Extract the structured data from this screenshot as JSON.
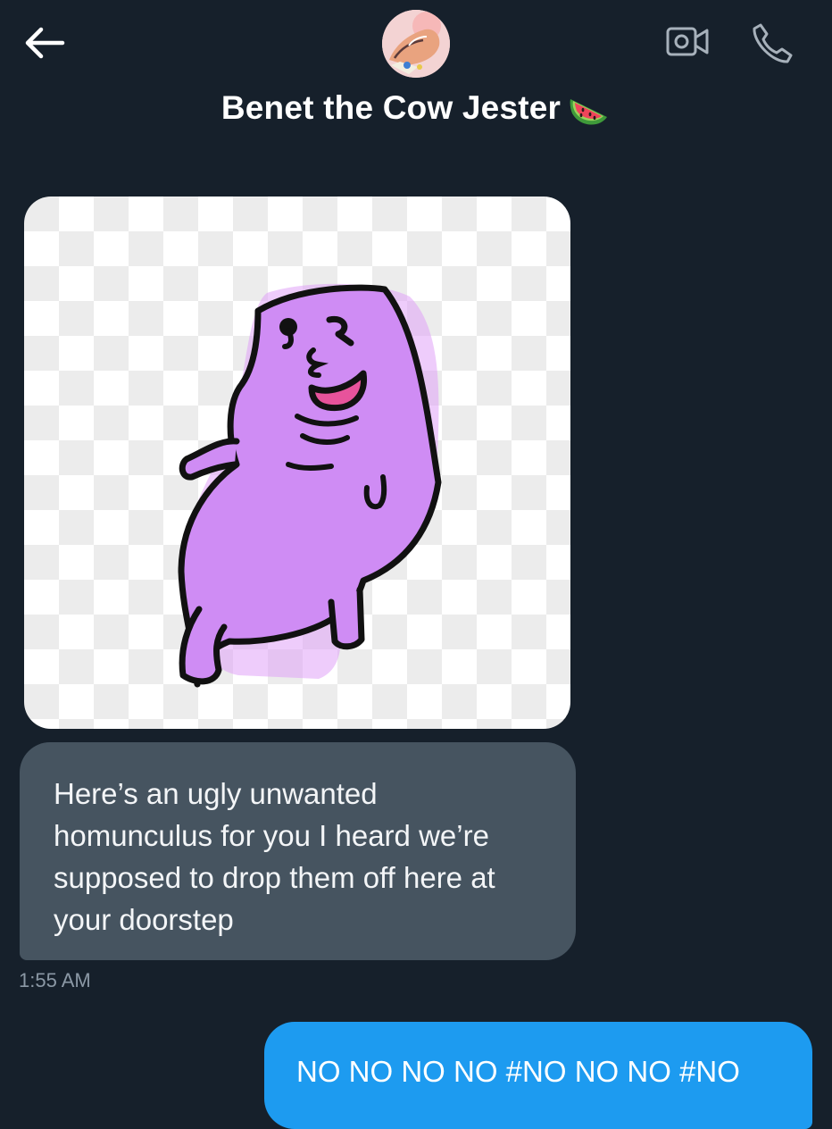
{
  "header": {
    "contact_name": "Benet the Cow Jester"
  },
  "messages": {
    "received_text": "Here’s an ugly unwanted homunculus for you I heard we’re supposed to drop them off here at your doorstep",
    "received_lines": [
      "Here’s an ugly unwanted",
      "homunculus for you I heard we’re",
      "supposed to drop them off here at",
      "your doorstep"
    ],
    "received_time": "1:55 AM",
    "sent_text": "NO NO NO NO #NO NO NO #NO"
  },
  "icons": {
    "back": "arrow-left-icon",
    "video": "video-camera-icon",
    "phone": "phone-icon",
    "emoji": "watermelon-emoji"
  },
  "colors": {
    "background": "#16202b",
    "received_bubble": "#465460",
    "sent_bubble": "#1d9bf0",
    "timestamp": "#8b98a5",
    "creature": "#cf8cf4"
  }
}
